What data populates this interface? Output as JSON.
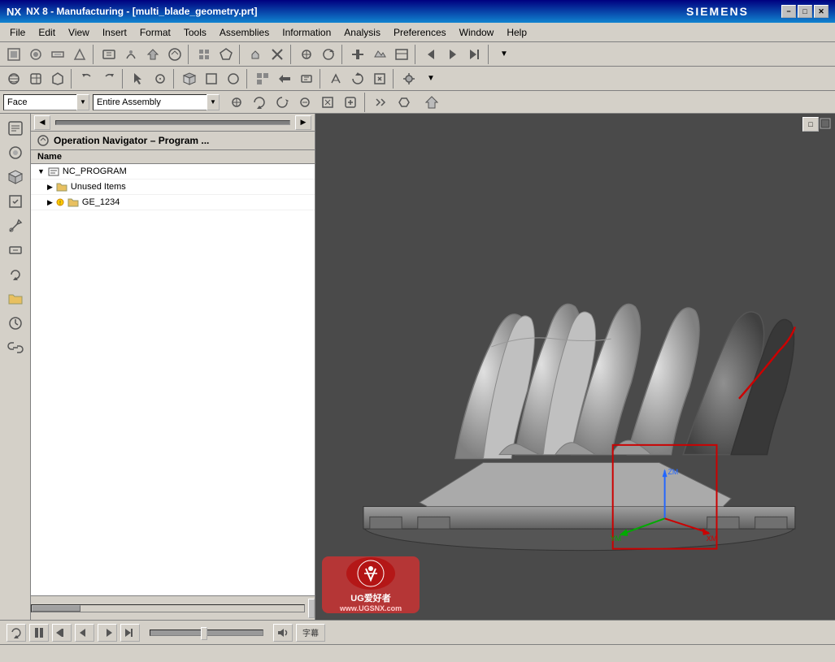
{
  "titlebar": {
    "title": "NX 8 - Manufacturing - [multi_blade_geometry.prt]",
    "brand": "SIEMENS",
    "min_label": "−",
    "max_label": "□",
    "close_label": "✕",
    "win_min": "−",
    "win_max": "□",
    "win_close": "✕"
  },
  "menubar": {
    "items": [
      "File",
      "Edit",
      "View",
      "Insert",
      "Format",
      "Tools",
      "Assemblies",
      "Information",
      "Analysis",
      "Preferences",
      "Window",
      "Help"
    ]
  },
  "filterbar": {
    "face_label": "Face",
    "assembly_label": "Entire Assembly",
    "arrow": "▼"
  },
  "navigator": {
    "title": "Operation Navigator – Program ...",
    "column_name": "Name",
    "items": [
      {
        "label": "NC_PROGRAM",
        "indent": 0,
        "icon": "folder"
      },
      {
        "label": "Unused Items",
        "indent": 1,
        "icon": "folder-small"
      },
      {
        "label": "GE_1234",
        "indent": 1,
        "icon": "gear"
      }
    ]
  },
  "sidebar_icons": [
    "🔧",
    "📋",
    "📐",
    "🔩",
    "📊",
    "⚙",
    "🔄",
    "📁",
    "⏱",
    "🔗"
  ],
  "bottom_controls": {
    "rewind_label": "⏮",
    "play_pause_label": "⏸",
    "prev_label": "⏪",
    "step_back_label": "⏴",
    "step_fwd_label": "⏵",
    "next_label": "⏩",
    "volume_label": "🔊",
    "caption_label": "字幕"
  },
  "watermark": {
    "line1": "UG爱好者",
    "line2": "www.UGSNX.com"
  },
  "colors": {
    "title_bg": "#000080",
    "toolbar_bg": "#d4d0c8",
    "viewport_bg": "#4a4a4a",
    "selection_box": "#cc0000",
    "axis_x": "#cc0000",
    "axis_y": "#00aa00",
    "axis_z": "#0000cc"
  }
}
